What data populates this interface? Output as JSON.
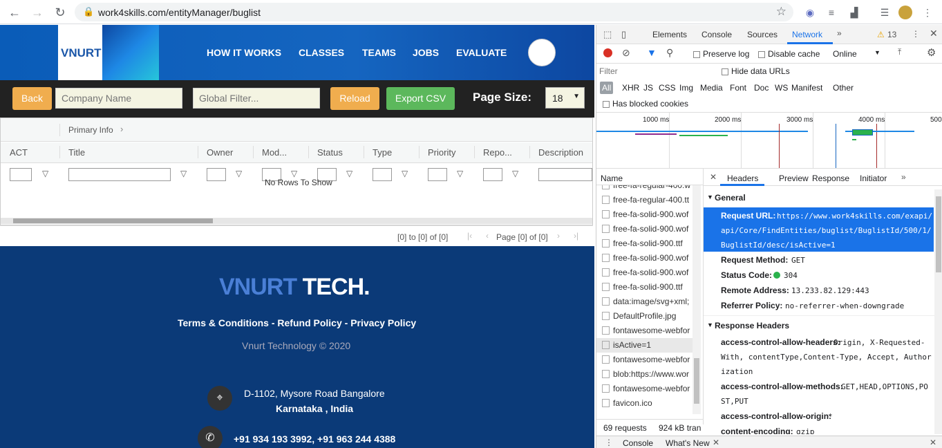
{
  "browser": {
    "url": "work4skills.com/entityManager/buglist"
  },
  "site": {
    "logo_text": "VNURT",
    "menu": [
      "HOW IT WORKS",
      "CLASSES",
      "TEAMS",
      "JOBS",
      "EVALUATE"
    ]
  },
  "toolbar": {
    "back": "Back",
    "company_placeholder": "Company Name",
    "global_placeholder": "Global Filter...",
    "reload": "Reload",
    "export": "Export CSV",
    "page_size_label": "Page Size:",
    "page_size_value": "18"
  },
  "grid": {
    "group_label": "Primary Info",
    "columns": [
      "ACT",
      "Title",
      "Owner",
      "Mod...",
      "Status",
      "Type",
      "Priority",
      "Repo...",
      "Description"
    ],
    "no_rows": "No Rows To Show"
  },
  "pager": {
    "range": "[0] to [0] of [0]",
    "page": "Page [0] of [0]"
  },
  "footer": {
    "brand_a": "VNURT",
    "brand_b": "TECH.",
    "links": "Terms & Conditions - Refund Policy - Privacy Policy",
    "copyright": "Vnurt Technology © 2020",
    "address1": "D-1102, Mysore Road Bangalore",
    "address2": "Karnataka , India",
    "phone": "+91 934 193 3992, +91 963 244 4388"
  },
  "devtools": {
    "tabs": [
      "Elements",
      "Console",
      "Sources",
      "Network"
    ],
    "active_tab": "Network",
    "warnings": "13",
    "preserve_log": "Preserve log",
    "disable_cache": "Disable cache",
    "throttle": "Online",
    "filter_placeholder": "Filter",
    "hide_data_urls": "Hide data URLs",
    "type_filters": [
      "All",
      "XHR",
      "JS",
      "CSS",
      "Img",
      "Media",
      "Font",
      "Doc",
      "WS",
      "Manifest",
      "Other"
    ],
    "has_blocked": "Has blocked cookies",
    "timeline_ticks": [
      "1000 ms",
      "2000 ms",
      "3000 ms",
      "4000 ms",
      "500"
    ],
    "name_header": "Name",
    "requests": [
      "free-fa-regular-400.w",
      "free-fa-regular-400.tt",
      "free-fa-solid-900.wof",
      "free-fa-solid-900.wof",
      "free-fa-solid-900.ttf",
      "free-fa-solid-900.wof",
      "free-fa-solid-900.wof",
      "free-fa-solid-900.ttf",
      "data:image/svg+xml;",
      "DefaultProfile.jpg",
      "fontawesome-webfor",
      "isActive=1",
      "fontawesome-webfor",
      "blob:https://www.wor",
      "fontawesome-webfor",
      "favicon.ico"
    ],
    "summary_requests": "69 requests",
    "summary_size": "924 kB tran",
    "detail_tabs": [
      "Headers",
      "Preview",
      "Response",
      "Initiator"
    ],
    "general_title": "General",
    "request_url_label": "Request URL:",
    "request_url_1": "https://www.work4skills.com/exapi/",
    "request_url_2": "api/Core/FindEntities/buglist/BuglistId/500/1/",
    "request_url_3": "BuglistId/desc/isActive=1",
    "method_label": "Request Method:",
    "method": "GET",
    "status_label": "Status Code:",
    "status": "304",
    "remote_label": "Remote Address:",
    "remote": "13.233.82.129:443",
    "referrer_label": "Referrer Policy:",
    "referrer": "no-referrer-when-downgrade",
    "response_headers_title": "Response Headers",
    "acah_label": "access-control-allow-headers:",
    "acah_1": "Origin, X-Requested-",
    "acah_2": "With, contentType,Content-Type, Accept, Author",
    "acah_3": "ization",
    "acam_label": "access-control-allow-methods:",
    "acam_1": "GET,HEAD,OPTIONS,PO",
    "acam_2": "ST,PUT",
    "acao_label": "access-control-allow-origin:",
    "acao": "*",
    "ce_label": "content-encoding:",
    "ce": "gzip",
    "drawer_tabs": [
      "Console",
      "What's New"
    ]
  }
}
